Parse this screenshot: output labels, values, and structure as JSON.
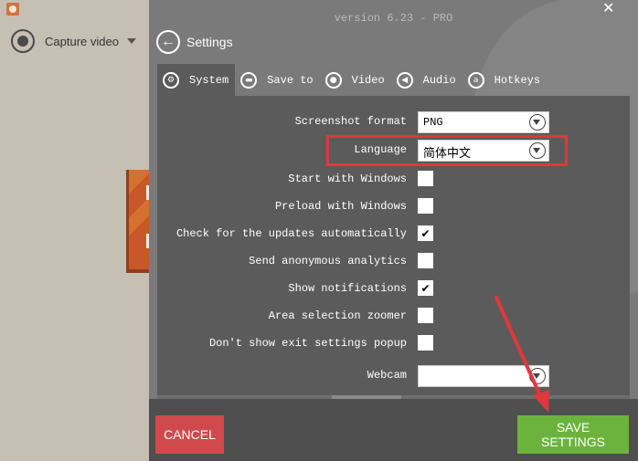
{
  "app": {
    "capture_mode_label": "Capture video"
  },
  "settings": {
    "version_text": "version 6.23 - PRO",
    "title": "Settings",
    "tabs": [
      {
        "label": "System",
        "icon": "gears-icon",
        "active": true
      },
      {
        "label": "Save to",
        "icon": "folder-icon",
        "active": false
      },
      {
        "label": "Video",
        "icon": "record-icon",
        "active": false
      },
      {
        "label": "Audio",
        "icon": "speaker-icon",
        "active": false
      },
      {
        "label": "Hotkeys",
        "icon": "key-icon",
        "active": false
      }
    ],
    "system": {
      "screenshot_format": {
        "label": "Screenshot format",
        "value": "PNG"
      },
      "language": {
        "label": "Language",
        "value": "简体中文"
      },
      "options": [
        {
          "label": "Start with Windows",
          "checked": false
        },
        {
          "label": "Preload with Windows",
          "checked": false
        },
        {
          "label": "Check for the updates automatically",
          "checked": true
        },
        {
          "label": "Send anonymous analytics",
          "checked": false
        },
        {
          "label": "Show notifications",
          "checked": true
        },
        {
          "label": "Area selection zoomer",
          "checked": false
        },
        {
          "label": "Don't show exit settings popup",
          "checked": false
        }
      ],
      "webcam": {
        "label": "Webcam",
        "value": ""
      }
    },
    "check_mark": "✔",
    "buttons": {
      "cancel": "CANCEL",
      "save": "SAVE SETTINGS"
    },
    "colors": {
      "cancel": "#d0494d",
      "save": "#6cb33e",
      "annotation": "#e0383b"
    }
  }
}
